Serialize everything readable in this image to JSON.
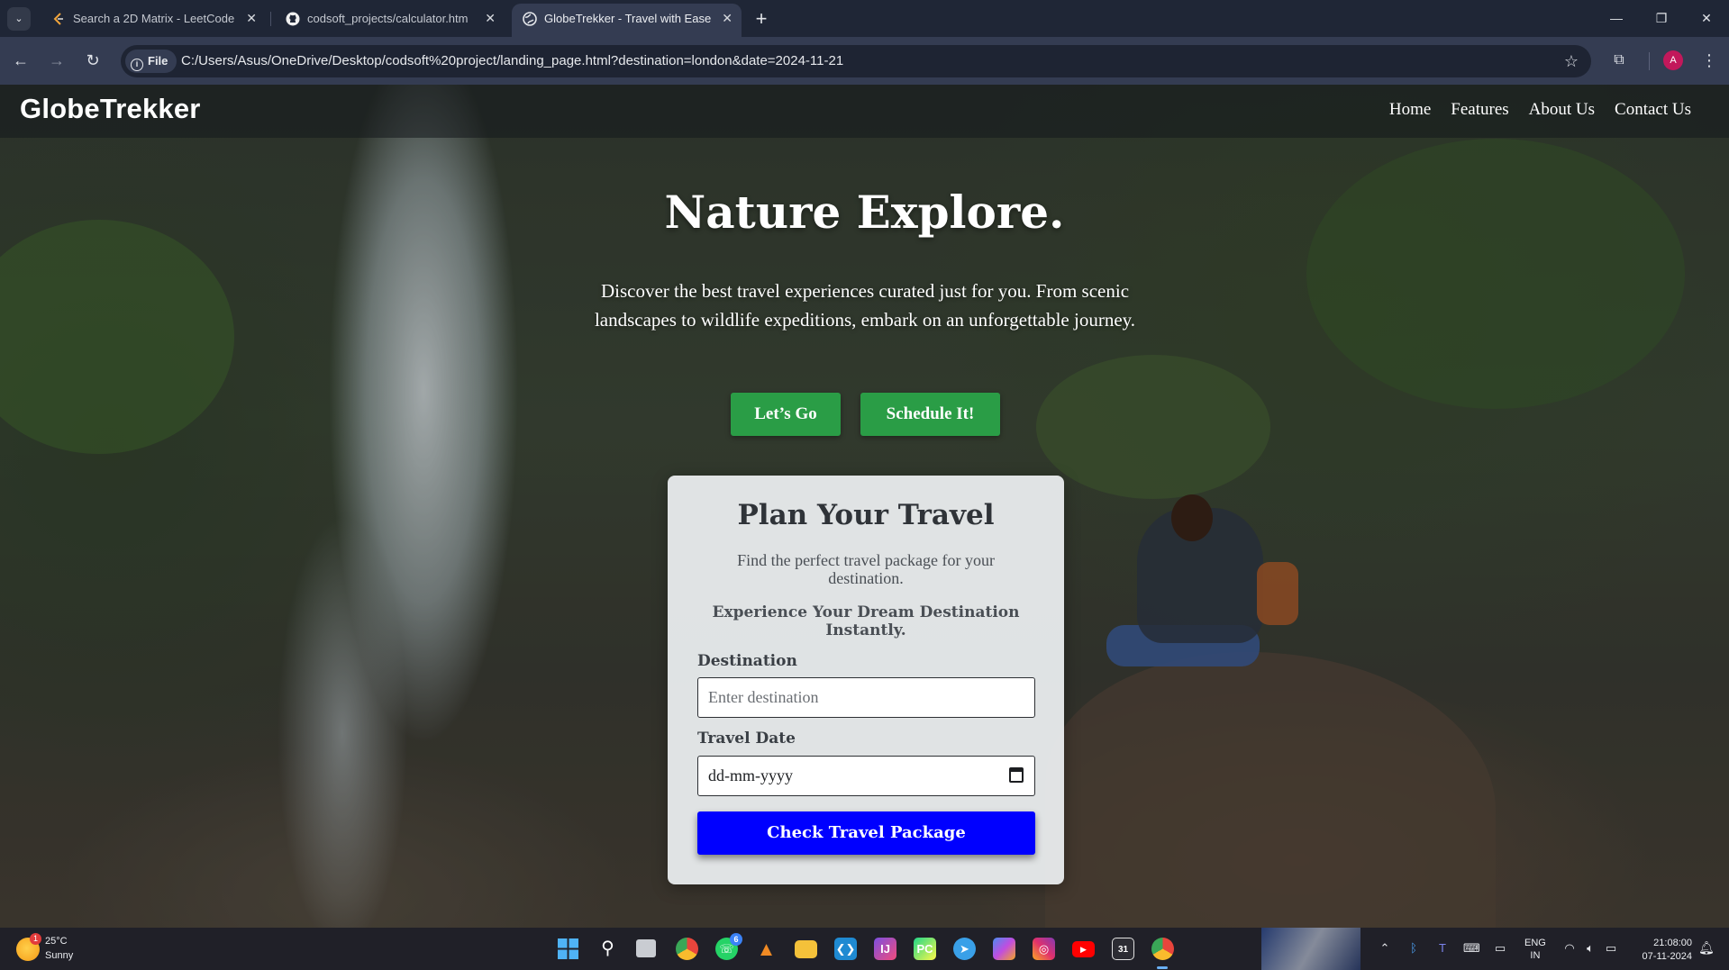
{
  "browser": {
    "tabs": [
      {
        "title": "Search a 2D Matrix - LeetCode",
        "icon": "leetcode-icon",
        "active": false
      },
      {
        "title": "codsoft_projects/calculator.htm",
        "icon": "github-icon",
        "active": false
      },
      {
        "title": "GlobeTrekker - Travel with Ease",
        "icon": "globe-icon",
        "active": true
      }
    ],
    "new_tab": "+",
    "address_chip": "File",
    "url": "C:/Users/Asus/OneDrive/Desktop/codsoft%20project/landing_page.html?destination=london&date=2024-11-21",
    "profile_initial": "A"
  },
  "site": {
    "logo": "GlobeTrekker",
    "nav": [
      "Home",
      "Features",
      "About Us",
      "Contact Us"
    ],
    "hero": {
      "title": "Nature Explore.",
      "subtitle": "Discover the best travel experiences curated just for you. From scenic landscapes to wildlife expeditions, embark on an unforgettable journey.",
      "buttons": [
        "Let’s Go",
        "Schedule It!"
      ]
    },
    "card": {
      "title": "Plan Your Travel",
      "subtitle": "Find the perfect travel package for your destination.",
      "tagline": "Experience Your Dream Destination Instantly.",
      "destination_label": "Destination",
      "destination_placeholder": "Enter destination",
      "date_label": "Travel Date",
      "date_placeholder": "dd-mm-yyyy",
      "submit": "Check Travel Package"
    },
    "colors": {
      "hero_button": "#2a9d46",
      "submit_button": "#0000ff"
    }
  },
  "taskbar": {
    "weather_temp": "25°C",
    "weather_desc": "Sunny",
    "weather_badge": "1",
    "whatsapp_badge": "6",
    "lang_line1": "ENG",
    "lang_line2": "IN",
    "time": "21:08:00",
    "date": "07-11-2024"
  }
}
